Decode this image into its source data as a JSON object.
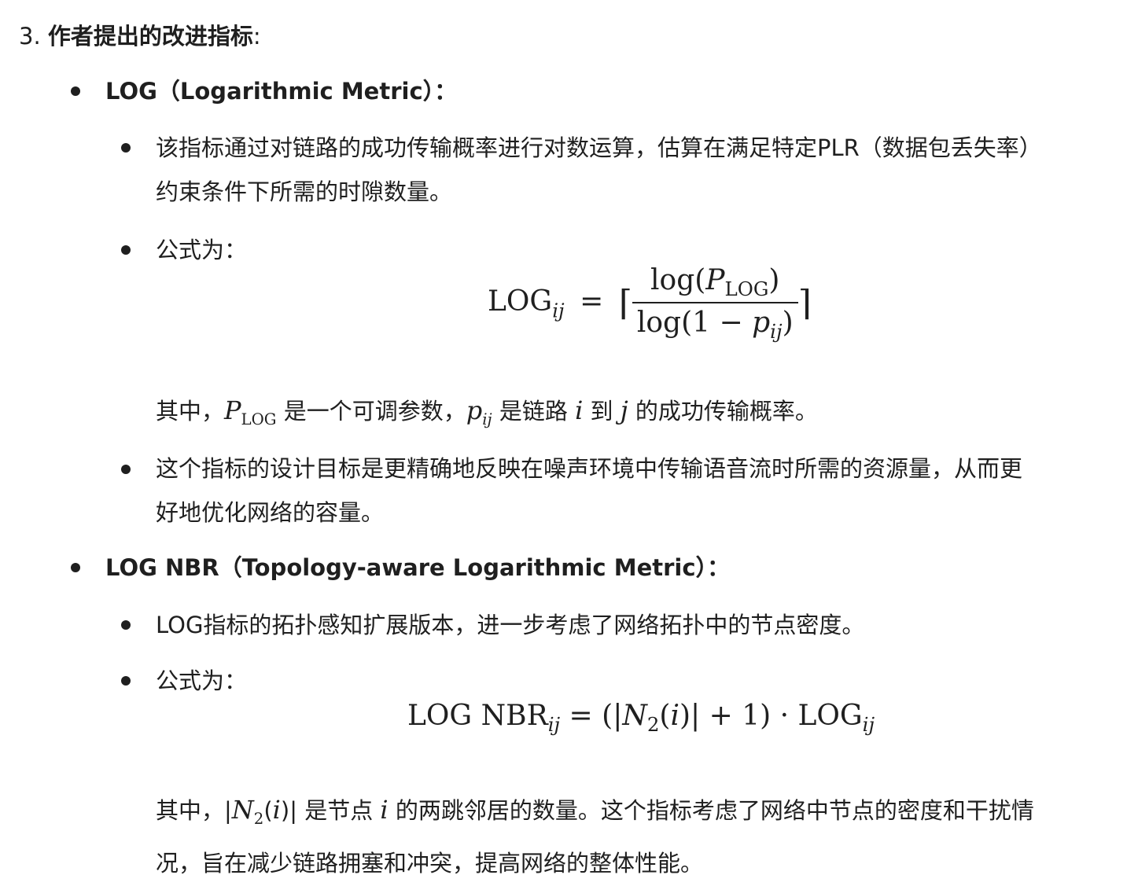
{
  "heading": {
    "number": "3.",
    "title": "作者提出的改进指标",
    "colon": ":"
  },
  "log": {
    "title": "LOG（Logarithmic Metric）：",
    "b1": "该指标通过对链路的成功传输概率进行对数运算，估算在满足特定PLR（数据包丢失率）",
    "b1_cont": "约束条件下所需的时隙数量。",
    "b2": "公式为：",
    "formula": {
      "lhs": "LOG",
      "lhs_sub": "ij",
      "eq": "=",
      "num_fn": "log(",
      "num_var": "P",
      "num_sub": "LOG",
      "num_close": ")",
      "den_fn": "log(1 − ",
      "den_var": "p",
      "den_sub": "ij",
      "den_close": ")"
    },
    "where": {
      "lead": "其中，",
      "P": "P",
      "P_sub": "LOG",
      "t1": " 是一个可调参数，",
      "p": "p",
      "p_sub": "ij",
      "t2": " 是链路 ",
      "i": "i",
      "t3": " 到 ",
      "j": "j",
      "t4": " 的成功传输概率。"
    },
    "b3": "这个指标的设计目标是更精确地反映在噪声环境中传输语音流时所需的资源量，从而更",
    "b3_cont": "好地优化网络的容量。"
  },
  "nbr": {
    "title": "LOG NBR（Topology-aware Logarithmic Metric）：",
    "b1": "LOG指标的拓扑感知扩展版本，进一步考虑了网络拓扑中的节点密度。",
    "b2": "公式为：",
    "formula": {
      "lhs": "LOG NBR",
      "lhs_sub": "ij",
      "eq": " = (|",
      "N": "N",
      "N_sub": "2",
      "arg": "(",
      "i": "i",
      "argc": ")| + 1) · LOG",
      "rhs_sub": "ij"
    },
    "where": {
      "lead": "其中，|",
      "N": "N",
      "N_sub": "2",
      "o": "(",
      "i": "i",
      "c": ")|",
      "t1": " 是节点 ",
      "i2": "i",
      "t2": " 的两跳邻居的数量。这个指标考虑了网络中节点的密度和干扰情"
    },
    "where_cont": "况，旨在减少链路拥塞和冲突，提高网络的整体性能。"
  }
}
